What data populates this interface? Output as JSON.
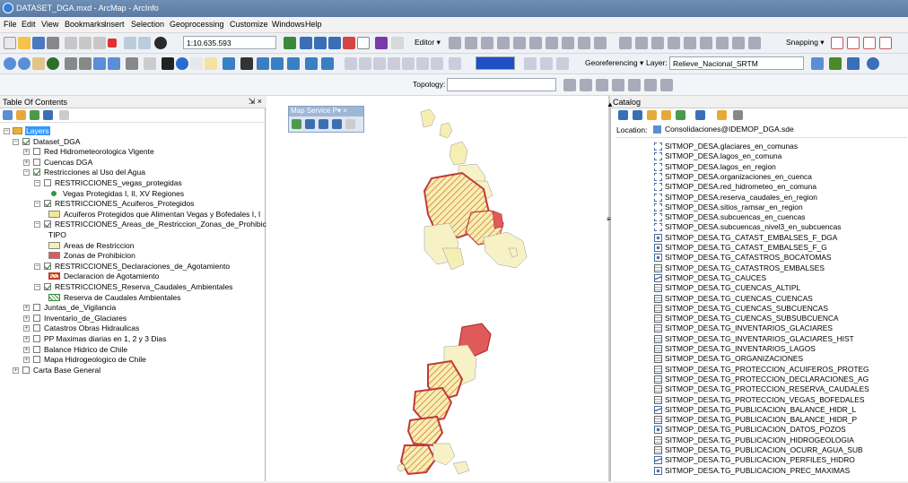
{
  "window": {
    "title": "DATASET_DGA.mxd - ArcMap - ArcInfo"
  },
  "menu": [
    "File",
    "Edit",
    "View",
    "Bookmarks",
    "Insert",
    "Selection",
    "Geoprocessing",
    "Customize",
    "Windows",
    "Help"
  ],
  "toolbar": {
    "scale": "1:10.635.593",
    "editor": "Editor ▾",
    "snapping": "Snapping ▾",
    "georeferencing": "Georeferencing ▾",
    "layer_label": "Layer:",
    "layer_value": "Relieve_Nacional_SRTM",
    "topology": "Topology:"
  },
  "toc": {
    "title": "Table Of Contents",
    "pin": "⇲ ×",
    "rows": [
      {
        "text": "Layers",
        "level": 0,
        "type": "root"
      },
      {
        "text": "Dataset_DGA",
        "level": 1,
        "checked": true
      },
      {
        "text": "Red Hidrometeorologica Vigente",
        "level": 2,
        "checked": false,
        "collapsed": true
      },
      {
        "text": "Cuencas DGA",
        "level": 2,
        "checked": false,
        "collapsed": true
      },
      {
        "text": "Restricciones al Uso del Agua",
        "level": 2,
        "checked": true
      },
      {
        "text": "RESTRICCIONES_vegas_protegidas",
        "level": 3,
        "checked": false
      },
      {
        "text": "Vegas Protegidas I, II, XV Regiones",
        "level": 4,
        "sym": "dot"
      },
      {
        "text": "RESTRICCIONES_Acuiferos_Protegidos",
        "level": 3,
        "checked": true
      },
      {
        "text": "Acuiferos Protegidos que Alimentan Vegas y Bofedales I, I",
        "level": 4,
        "sym": "yellow"
      },
      {
        "text": "RESTRICCIONES_Areas_de_Restriccion_Zonas_de_Prohibicion",
        "level": 3,
        "checked": true
      },
      {
        "text": "TIPO",
        "level": 4,
        "sym": "none"
      },
      {
        "text": "Areas de Restriccion",
        "level": 4,
        "sym": "paleyellow"
      },
      {
        "text": "Zonas de Prohibicion",
        "level": 4,
        "sym": "red"
      },
      {
        "text": "RESTRICCIONES_Declaraciones_de_Agotamiento",
        "level": 3,
        "checked": true
      },
      {
        "text": "Declaracion de Agotamiento",
        "level": 4,
        "sym": "hatchred"
      },
      {
        "text": "RESTRICCIONES_Reserva_Caudales_Ambientales",
        "level": 3,
        "checked": true
      },
      {
        "text": "Reserva de Caudales Ambientales",
        "level": 4,
        "sym": "hatchgreen"
      },
      {
        "text": "Juntas_de_Vigilancia",
        "level": 2,
        "checked": false,
        "collapsed": true
      },
      {
        "text": "Inventario_de_Glaciares",
        "level": 2,
        "checked": false,
        "collapsed": true
      },
      {
        "text": "Catastros Obras Hidraulicas",
        "level": 2,
        "checked": false,
        "collapsed": true
      },
      {
        "text": "PP Maximas diarias en 1, 2 y 3 Dias",
        "level": 2,
        "checked": false,
        "collapsed": true
      },
      {
        "text": "Balance Hidrico de Chile",
        "level": 2,
        "checked": false,
        "collapsed": true
      },
      {
        "text": "Mapa Hidrogeologico de Chile",
        "level": 2,
        "checked": false,
        "collapsed": true
      },
      {
        "text": "Carta Base General",
        "level": 1,
        "checked": false,
        "collapsed": true
      }
    ]
  },
  "map_service": {
    "title": "Map Service P▾ ×"
  },
  "catalog": {
    "title": "Catalog",
    "location_label": "Location:",
    "location_value": "Consolidaciones@IDEMOP_DGA.sde",
    "items": [
      {
        "text": "SITMOP_DESA.glaciares_en_comunas",
        "icon": "rel"
      },
      {
        "text": "SITMOP_DESA.lagos_en_comuna",
        "icon": "rel"
      },
      {
        "text": "SITMOP_DESA.lagos_en_region",
        "icon": "rel"
      },
      {
        "text": "SITMOP_DESA.organizaciones_en_cuenca",
        "icon": "rel"
      },
      {
        "text": "SITMOP_DESA.red_hidrometeo_en_comuna",
        "icon": "rel"
      },
      {
        "text": "SITMOP_DESA.reserva_caudales_en_region",
        "icon": "rel"
      },
      {
        "text": "SITMOP_DESA.sitios_ramsar_en_region",
        "icon": "rel"
      },
      {
        "text": "SITMOP_DESA.subcuencas_en_cuencas",
        "icon": "rel"
      },
      {
        "text": "SITMOP_DESA.subcuencas_nivel3_en_subcuencas",
        "icon": "rel"
      },
      {
        "text": "SITMOP_DESA.TG_CATAST_EMBALSES_F_DGA",
        "icon": "pt"
      },
      {
        "text": "SITMOP_DESA.TG_CATAST_EMBALSES_F_G",
        "icon": "pt"
      },
      {
        "text": "SITMOP_DESA.TG_CATASTROS_BOCATOMAS",
        "icon": "pt"
      },
      {
        "text": "SITMOP_DESA.TG_CATASTROS_EMBALSES",
        "icon": "tbl"
      },
      {
        "text": "SITMOP_DESA.TG_CAUCES",
        "icon": "line"
      },
      {
        "text": "SITMOP_DESA.TG_CUENCAS_ALTIPL",
        "icon": "tbl"
      },
      {
        "text": "SITMOP_DESA.TG_CUENCAS_CUENCAS",
        "icon": "tbl"
      },
      {
        "text": "SITMOP_DESA.TG_CUENCAS_SUBCUENCAS",
        "icon": "tbl"
      },
      {
        "text": "SITMOP_DESA.TG_CUENCAS_SUBSUBCUENCA",
        "icon": "tbl"
      },
      {
        "text": "SITMOP_DESA.TG_INVENTARIOS_GLACIARES",
        "icon": "tbl"
      },
      {
        "text": "SITMOP_DESA.TG_INVENTARIOS_GLACIARES_HIST",
        "icon": "tbl"
      },
      {
        "text": "SITMOP_DESA.TG_INVENTARIOS_LAGOS",
        "icon": "tbl"
      },
      {
        "text": "SITMOP_DESA.TG_ORGANIZACIONES",
        "icon": "tbl"
      },
      {
        "text": "SITMOP_DESA.TG_PROTECCION_ACUIFEROS_PROTEG",
        "icon": "tbl"
      },
      {
        "text": "SITMOP_DESA.TG_PROTECCION_DECLARACIONES_AG",
        "icon": "tbl"
      },
      {
        "text": "SITMOP_DESA.TG_PROTECCION_RESERVA_CAUDALES",
        "icon": "tbl"
      },
      {
        "text": "SITMOP_DESA.TG_PROTECCION_VEGAS_BOFEDALES",
        "icon": "tbl"
      },
      {
        "text": "SITMOP_DESA.TG_PUBLICACION_BALANCE_HIDR_L",
        "icon": "line"
      },
      {
        "text": "SITMOP_DESA.TG_PUBLICACION_BALANCE_HIDR_P",
        "icon": "tbl"
      },
      {
        "text": "SITMOP_DESA.TG_PUBLICACION_DATOS_POZOS",
        "icon": "pt"
      },
      {
        "text": "SITMOP_DESA.TG_PUBLICACION_HIDROGEOLOGIA",
        "icon": "tbl"
      },
      {
        "text": "SITMOP_DESA.TG_PUBLICACION_OCURR_AGUA_SUB",
        "icon": "tbl"
      },
      {
        "text": "SITMOP_DESA.TG_PUBLICACION_PERFILES_HIDRO",
        "icon": "line"
      },
      {
        "text": "SITMOP_DESA.TG_PUBLICACION_PREC_MAXIMAS",
        "icon": "pt"
      }
    ]
  },
  "colors": {
    "restriccion": "#f6efb4",
    "prohibicion": "#e05a5a",
    "agotamiento": "#d9702e",
    "base": "#f7f1c6"
  }
}
